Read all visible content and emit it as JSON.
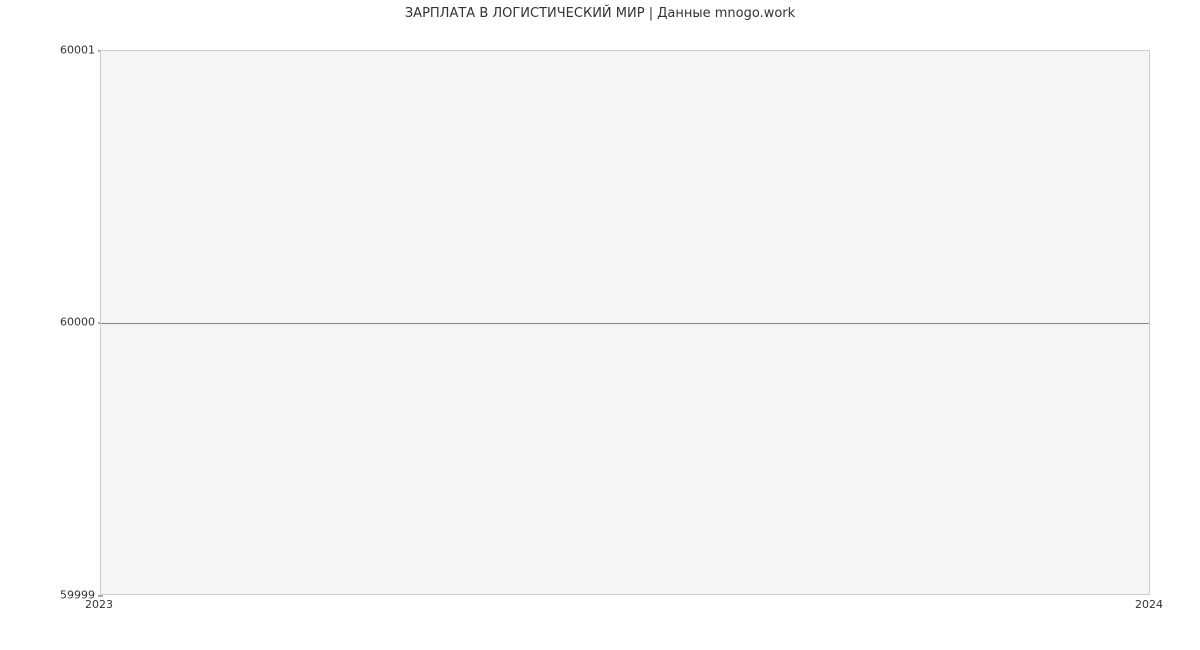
{
  "chart_data": {
    "type": "line",
    "title": "ЗАРПЛАТА В ЛОГИСТИЧЕСКИЙ МИР | Данные mnogo.work",
    "xlabel": "",
    "ylabel": "",
    "x": [
      "2023",
      "2024"
    ],
    "values": [
      60000,
      60000
    ],
    "ylim": [
      59999,
      60001
    ],
    "y_ticks": [
      "59999",
      "60000",
      "60001"
    ],
    "x_ticks": [
      "2023",
      "2024"
    ],
    "line_color": "#4a90e2",
    "plot_bg": "#f5f5f5"
  }
}
